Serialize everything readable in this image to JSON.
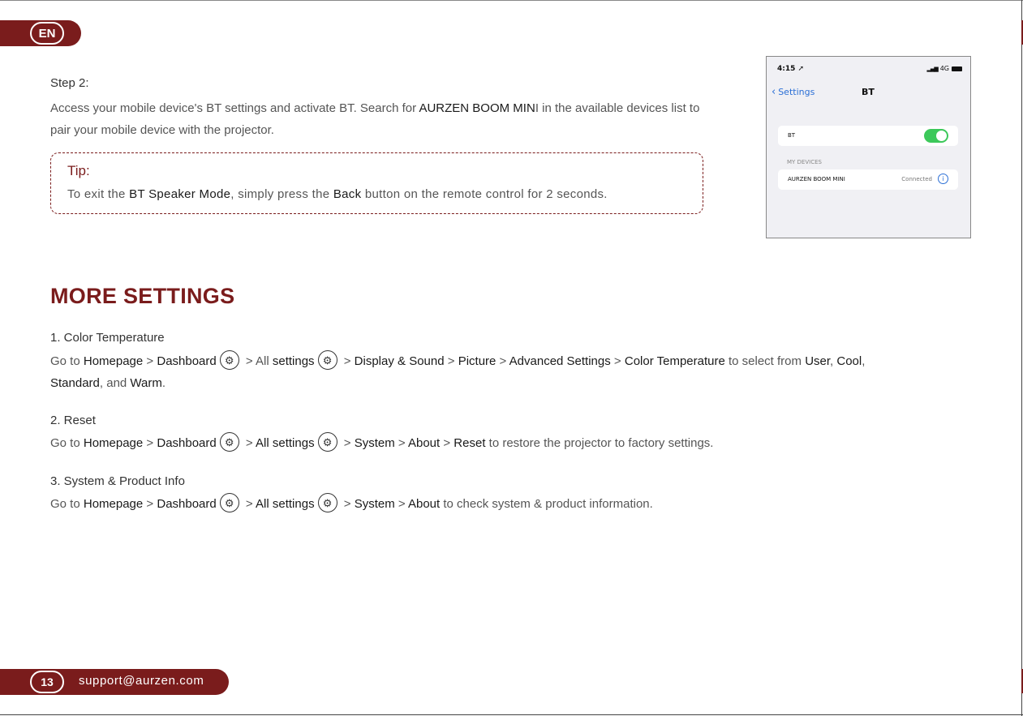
{
  "header": {
    "lang": "EN"
  },
  "step2": {
    "title": "Step 2:",
    "t1": "Access your mobile device's BT settings and activate BT. Search for ",
    "b1": "AURZEN BOOM MIN",
    "t2": "I in the available devices list to pair your mobile device with the projector."
  },
  "tip": {
    "title": "Tip:",
    "t1": "To exit the ",
    "b1": "BT Speaker Mode",
    "t2": ", simply press the ",
    "b2": "Back",
    "t3": " button on the remote control for 2 seconds."
  },
  "phone": {
    "time": "4:15",
    "signal": "4G",
    "back_label": "Settings",
    "title": "BT",
    "bt_label": "BT",
    "section": "MY DEVICES",
    "device_name": "AURZEN BOOM MINI",
    "device_status": "Connected",
    "info": "i"
  },
  "section_heading": "MORE SETTINGS",
  "settings": {
    "s1": {
      "title": "1. Color Temperature",
      "t1": "Go to ",
      "b1": "Homepage",
      "t2": " > ",
      "b2": "Dashboard",
      "t3": " > All ",
      "b3": "settings",
      "t4": " > ",
      "b4": "Display & Sound",
      "t5": " > ",
      "b5": "Picture",
      "t6": " > ",
      "b6": "Advanced Settings",
      "t7": " > ",
      "b7": "Color Temperature",
      "t8": " to select from ",
      "b8": "User",
      "t9": ", ",
      "b9": "Cool",
      "t10": ",",
      "b10": "Standard",
      "t11": ", and ",
      "b11": "Warm",
      "t12": "."
    },
    "s2": {
      "title": "2. Reset",
      "t1": "Go to ",
      "b1": "Homepage",
      "t2": " > ",
      "b2": "Dashboard",
      "t3": " > ",
      "b3": "All settings",
      "t4": " > ",
      "b4": "System",
      "t5": " > ",
      "b5": "About",
      "t6": " > ",
      "b6": "Reset",
      "t7": " to restore the projector to factory settings."
    },
    "s3": {
      "title": "3. System & Product Info",
      "t1": "Go to ",
      "b1": "Homepage",
      "t2": " > ",
      "b2": "Dashboard",
      "t3": " > ",
      "b3": "All settings",
      "t4": " > ",
      "b4": "System",
      "t5": " > ",
      "b5": "About",
      "t6": " to check system & product information."
    },
    "gear_icon": "gear-icon"
  },
  "footer": {
    "page": "13",
    "email": "support@aurzen.com"
  },
  "colors": {
    "accent": "#7a1c1c",
    "toggle_on": "#3cc85a",
    "ios_blue": "#2b6fd6"
  }
}
